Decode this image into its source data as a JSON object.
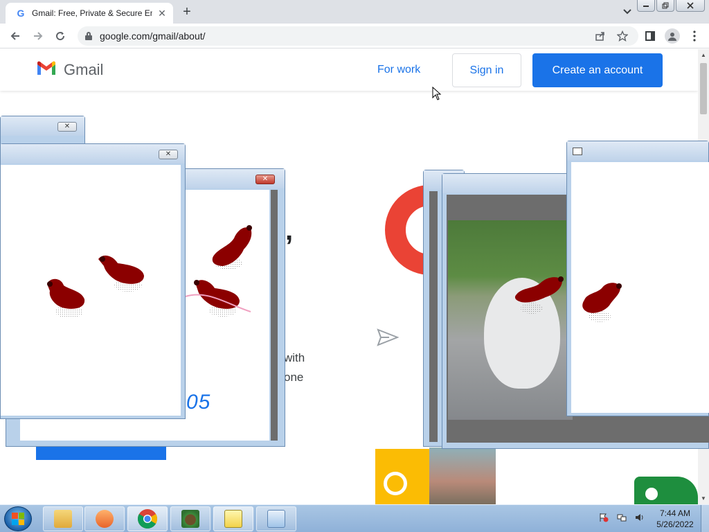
{
  "browser": {
    "tab_title": "Gmail: Free, Private & Secure Em",
    "tab_favicon": "G",
    "url": "google.com/gmail/about/",
    "new_tab": "+",
    "tab_close": "✕"
  },
  "gmail": {
    "logo_text": "Gmail",
    "for_work": "For work",
    "sign_in": "Sign in",
    "create_account": "Create an account",
    "fragments": {
      "with": "with",
      "one": "one",
      "blue_text": "05"
    }
  },
  "windows": [
    {
      "name": "stray-window-1",
      "close": "✕"
    },
    {
      "name": "stray-window-2",
      "close": "✕"
    },
    {
      "name": "stray-window-3",
      "close": "✕"
    }
  ],
  "taskbar": {
    "time": "7:44 AM",
    "date": "5/26/2022",
    "apps": [
      "file-explorer",
      "media-player",
      "chrome",
      "paint",
      "graph-app",
      "notepad"
    ]
  },
  "colors": {
    "gmail_blue": "#1a73e8",
    "gmail_red": "#ea4335",
    "bird_red": "#8b0000"
  }
}
